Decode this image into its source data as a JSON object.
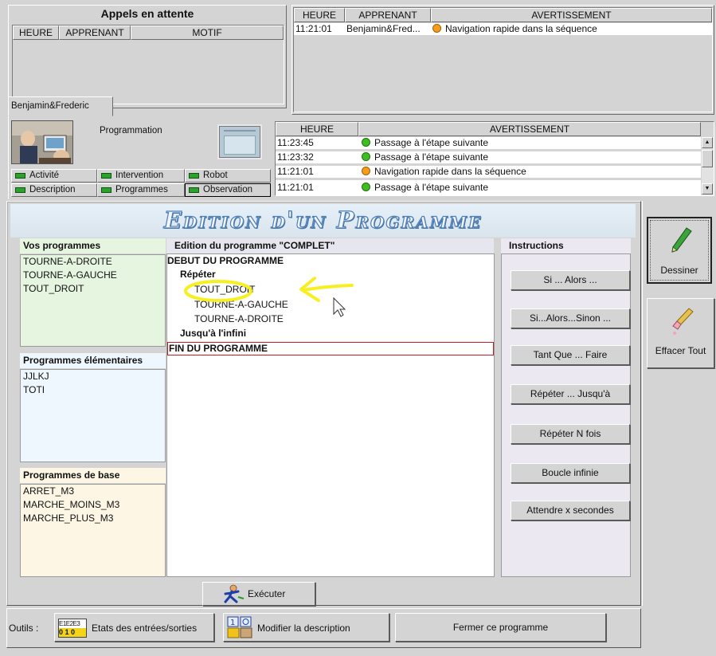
{
  "calls_panel": {
    "title": "Appels en attente",
    "columns": [
      "HEURE",
      "APPRENANT",
      "MOTIF"
    ]
  },
  "top_alerts": {
    "columns": [
      "HEURE",
      "APPRENANT",
      "AVERTISSEMENT"
    ],
    "rows": [
      {
        "time": "11:21:01",
        "learner": "Benjamin&Fred...",
        "status": "orange",
        "message": "Navigation rapide dans la séquence"
      }
    ]
  },
  "learner_tab": "Benjamin&Frederic",
  "learner_card": {
    "activity_label": "Programmation",
    "buttons": [
      "Activité",
      "Intervention",
      "Robot",
      "Description",
      "Programmes",
      "Observation"
    ]
  },
  "learner_alerts": {
    "columns": [
      "HEURE",
      "AVERTISSEMENT"
    ],
    "rows": [
      {
        "time": "11:23:45",
        "status": "green",
        "message": "Passage à l'étape suivante"
      },
      {
        "time": "11:23:32",
        "status": "green",
        "message": "Passage à l'étape suivante"
      },
      {
        "time": "11:21:01",
        "status": "orange",
        "message": "Navigation rapide dans la séquence"
      },
      {
        "time": "11:21:01",
        "status": "green",
        "message": "Passage à l'étape suivante"
      }
    ]
  },
  "editor": {
    "title": "Edition d'un Programme",
    "my_programs": {
      "header": "Vos programmes",
      "items": [
        "TOURNE-A-DROITE",
        "TOURNE-A-GAUCHE",
        "TOUT_DROIT"
      ]
    },
    "elementary_programs": {
      "header": "Programmes élémentaires",
      "items": [
        "JJLKJ",
        "TOTI"
      ]
    },
    "base_programs": {
      "header": "Programmes de base",
      "items": [
        "ARRET_M3",
        "MARCHE_MOINS_M3",
        "MARCHE_PLUS_M3"
      ]
    },
    "program_header": "Edition du programme \"COMPLET\"",
    "program_lines": {
      "start": "DEBUT DU PROGRAMME",
      "repeat": "Répéter",
      "step1": "TOUT_DROIT",
      "step2": "TOURNE-A-GAUCHE",
      "step3": "TOURNE-A-DROITE",
      "until": "Jusqu'à l'infini",
      "end": "FIN DU PROGRAMME"
    },
    "instructions": {
      "header": "Instructions",
      "buttons": [
        "Si ... Alors ...",
        "Si...Alors...Sinon ...",
        "Tant Que ... Faire",
        "Répéter ... Jusqu'à",
        "Répéter N fois",
        "Boucle infinie",
        "Attendre x secondes"
      ]
    },
    "execute_label": "Exécuter"
  },
  "side_tools": {
    "draw_label": "Dessiner",
    "erase_label": "Effacer Tout"
  },
  "toolbar": {
    "tools_label": "Outils :",
    "io_states_label": "Etats des entrées/sorties",
    "io_icon_top": "E1E2E3",
    "io_icon_bottom": "0 1 0",
    "modify_description_label": "Modifier la description",
    "close_program_label": "Fermer ce programme"
  },
  "colors": {
    "title_gradient_light": "#e3f0fb",
    "title_gradient_dark": "#6a95c5",
    "my_programs_bg": "#e6f5e0",
    "elementary_bg": "#eef7fd",
    "base_bg": "#fdf6e4",
    "instructions_bg": "#ece8f2",
    "annotation": "#f7f020",
    "selected_line_border": "#c02020"
  }
}
